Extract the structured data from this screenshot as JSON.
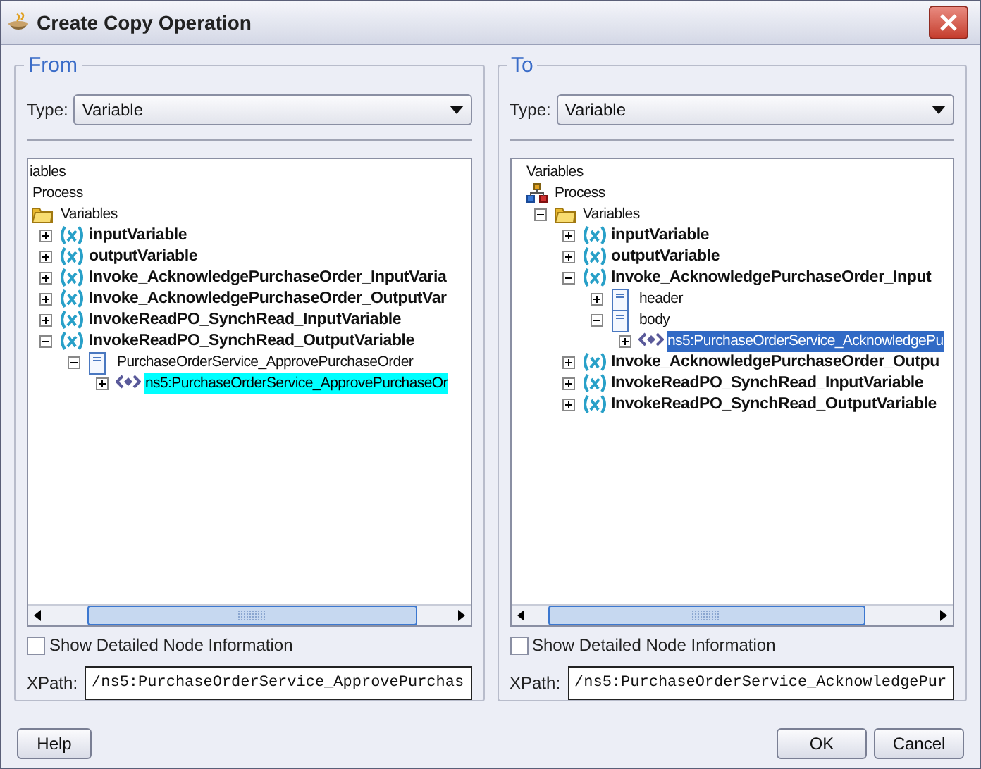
{
  "window": {
    "title": "Create Copy Operation"
  },
  "panels": [
    {
      "title": "From",
      "type_label": "Type:",
      "type_value": "Variable",
      "tree_focused": false,
      "tree": [
        {
          "label": "iables",
          "selected": false,
          "children": [
            {
              "label": "Process",
              "selected": false,
              "children": [
                {
                  "kind": "folder",
                  "label": "Variables",
                  "selected": false,
                  "children": [
                    {
                      "kind": "variable",
                      "label": "inputVariable",
                      "expanded": false,
                      "selected": false
                    },
                    {
                      "kind": "variable",
                      "label": "outputVariable",
                      "expanded": false,
                      "selected": false
                    },
                    {
                      "kind": "variable",
                      "label": "Invoke_AcknowledgePurchaseOrder_InputVaria",
                      "expanded": false,
                      "selected": false
                    },
                    {
                      "kind": "variable",
                      "label": "Invoke_AcknowledgePurchaseOrder_OutputVar",
                      "expanded": false,
                      "selected": false
                    },
                    {
                      "kind": "variable",
                      "label": "InvokeReadPO_SynchRead_InputVariable",
                      "expanded": false,
                      "selected": false
                    },
                    {
                      "kind": "variable",
                      "label": "InvokeReadPO_SynchRead_OutputVariable",
                      "expanded": true,
                      "selected": false,
                      "children": [
                        {
                          "kind": "part",
                          "label": "PurchaseOrderService_ApprovePurchaseOrder",
                          "expanded": true,
                          "selected": false,
                          "children": [
                            {
                              "kind": "element",
                              "label": "ns5:PurchaseOrderService_ApprovePurchaseOr",
                              "expanded": false,
                              "selected": true
                            }
                          ]
                        }
                      ]
                    }
                  ]
                }
              ]
            }
          ]
        }
      ],
      "detail_label": "Show Detailed Node Information",
      "detail_checked": false,
      "xpath_label": "XPath:",
      "xpath_value": "/ns5:PurchaseOrderService_ApprovePurchas"
    },
    {
      "title": "To",
      "type_label": "Type:",
      "type_value": "Variable",
      "tree_focused": true,
      "tree": [
        {
          "label": "Variables",
          "selected": false,
          "children": [
            {
              "kind": "process",
              "label": "Process",
              "selected": false,
              "children": [
                {
                  "kind": "folder",
                  "label": "Variables",
                  "expanded": true,
                  "selected": false,
                  "children": [
                    {
                      "kind": "variable",
                      "label": "inputVariable",
                      "expanded": false,
                      "selected": false
                    },
                    {
                      "kind": "variable",
                      "label": "outputVariable",
                      "expanded": false,
                      "selected": false
                    },
                    {
                      "kind": "variable",
                      "label": "Invoke_AcknowledgePurchaseOrder_Input",
                      "expanded": true,
                      "selected": false,
                      "children": [
                        {
                          "kind": "part",
                          "label": "header",
                          "expanded": false,
                          "selected": false
                        },
                        {
                          "kind": "part",
                          "label": "body",
                          "expanded": true,
                          "selected": false,
                          "children": [
                            {
                              "kind": "element",
                              "label": "ns5:PurchaseOrderService_AcknowledgePu",
                              "expanded": false,
                              "selected": true
                            }
                          ]
                        }
                      ]
                    },
                    {
                      "kind": "variable",
                      "label": "Invoke_AcknowledgePurchaseOrder_Outpu",
                      "expanded": false,
                      "selected": false
                    },
                    {
                      "kind": "variable",
                      "label": "InvokeReadPO_SynchRead_InputVariable",
                      "expanded": false,
                      "selected": false
                    },
                    {
                      "kind": "variable",
                      "label": "InvokeReadPO_SynchRead_OutputVariable",
                      "expanded": false,
                      "selected": false
                    }
                  ]
                }
              ]
            }
          ]
        }
      ],
      "detail_label": "Show Detailed Node Information",
      "detail_checked": false,
      "xpath_label": "XPath:",
      "xpath_value": "/ns5:PurchaseOrderService_AcknowledgePur"
    }
  ],
  "buttons": [
    {
      "label": "Help",
      "kind": "help"
    },
    {
      "label": "OK",
      "kind": "ok"
    },
    {
      "label": "Cancel",
      "kind": "cancel"
    }
  ]
}
